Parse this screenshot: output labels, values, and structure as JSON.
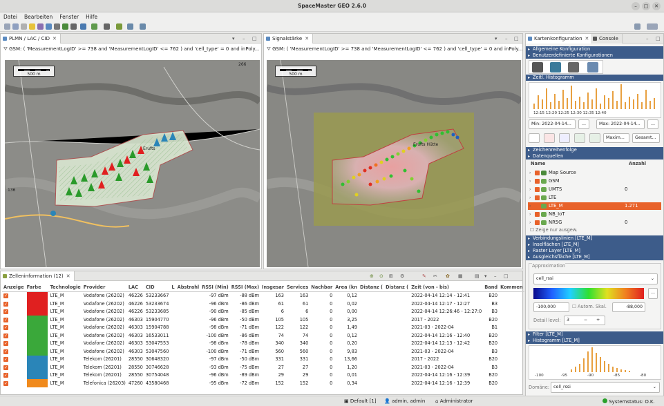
{
  "app": {
    "title": "SpaceMaster GEO 2.6.0"
  },
  "menu": [
    "Datei",
    "Bearbeiten",
    "Fenster",
    "Hilfe"
  ],
  "left_map": {
    "tab_label": "PLMN / LAC / CID",
    "filter_text": "GSM: ( 'MeasurementLogID' >= 738 and 'MeasurementLogID' <= 762 ) and 'cell_type' = 0 and inPoly...",
    "scale_label": "500 m",
    "place_label": "Erufts",
    "road_label": "136",
    "road_label2": "266"
  },
  "right_map": {
    "tab_label": "Signalstärke",
    "filter_text": "GSM: ( 'MeasurementLogID' >= 738 and 'MeasurementLogID' <= 762 ) and 'cell_type' = 0 and inPoly...",
    "scale_label": "500 m",
    "place_label": "Erufts Hütte"
  },
  "cells": {
    "tab_label": "Zelleninformation (12)",
    "columns": [
      "Anzeige",
      "Farbe",
      "Technologie",
      "Provider",
      "LAC",
      "CID",
      "L",
      "Abstrahl",
      "RSSI (Min)",
      "RSSI (Max)",
      "Insgesar",
      "Services",
      "Nachbar",
      "Area (kn",
      "Distanz (",
      "Distanz (",
      "Zeit (von - bis)",
      "Band",
      "Kommen"
    ],
    "rows": [
      {
        "color": "#e02020",
        "tech": "LTE_M",
        "provider": "Vodafone (26202)",
        "lac": "46226",
        "cid": "53233667",
        "rmin": "-97 dBm",
        "rmax": "-88 dBm",
        "ins": "163",
        "srv": "163",
        "nb": "0",
        "area": "0,12",
        "time": "2022-04-14 12:14 - 12:41",
        "band": "B20"
      },
      {
        "color": "#e02020",
        "tech": "LTE_M",
        "provider": "Vodafone (26202)",
        "lac": "46226",
        "cid": "53233674",
        "rmin": "-96 dBm",
        "rmax": "-86 dBm",
        "ins": "61",
        "srv": "61",
        "nb": "0",
        "area": "0,02",
        "time": "2022-04-14 12:17 - 12:27",
        "band": "B3"
      },
      {
        "color": "#e02020",
        "tech": "LTE_M",
        "provider": "Vodafone (26202)",
        "lac": "46226",
        "cid": "53233685",
        "rmin": "-90 dBm",
        "rmax": "-85 dBm",
        "ins": "6",
        "srv": "6",
        "nb": "0",
        "area": "0,00",
        "time": "2022-04-14 12:26:46 - 12:27:0",
        "band": "B3"
      },
      {
        "color": "#3aa83a",
        "tech": "LTE_M",
        "provider": "Vodafone (26202)",
        "lac": "46303",
        "cid": "15904770",
        "rmin": "-96 dBm",
        "rmax": "-50 dBm",
        "ins": "105",
        "srv": "105",
        "nb": "0",
        "area": "3,25",
        "time": "2017 - 2022",
        "band": "B20"
      },
      {
        "color": "#3aa83a",
        "tech": "LTE_M",
        "provider": "Vodafone (26202)",
        "lac": "46303",
        "cid": "15904788",
        "rmin": "-98 dBm",
        "rmax": "-71 dBm",
        "ins": "122",
        "srv": "122",
        "nb": "0",
        "area": "1,49",
        "time": "2021-03 - 2022-04",
        "band": "B1"
      },
      {
        "color": "#3aa83a",
        "tech": "LTE_M",
        "provider": "Vodafone (26202)",
        "lac": "46303",
        "cid": "16533011",
        "rmin": "-100 dBm",
        "rmax": "-86 dBm",
        "ins": "74",
        "srv": "74",
        "nb": "0",
        "area": "0,12",
        "time": "2022-04-14 12:16 - 12:40",
        "band": "B20"
      },
      {
        "color": "#3aa83a",
        "tech": "LTE_M",
        "provider": "Vodafone (26202)",
        "lac": "46303",
        "cid": "53047553",
        "rmin": "-98 dBm",
        "rmax": "-78 dBm",
        "ins": "340",
        "srv": "340",
        "nb": "0",
        "area": "0,20",
        "time": "2022-04-14 12:13 - 12:42",
        "band": "B20"
      },
      {
        "color": "#3aa83a",
        "tech": "LTE_M",
        "provider": "Vodafone (26202)",
        "lac": "46303",
        "cid": "53047560",
        "rmin": "-100 dBm",
        "rmax": "-71 dBm",
        "ins": "560",
        "srv": "560",
        "nb": "0",
        "area": "9,83",
        "time": "2021-03 - 2022-04",
        "band": "B3"
      },
      {
        "color": "#2a85b8",
        "tech": "LTE_M",
        "provider": "Telekom (26201)",
        "lac": "28550",
        "cid": "30648320",
        "rmin": "-97 dBm",
        "rmax": "-50 dBm",
        "ins": "331",
        "srv": "331",
        "nb": "0",
        "area": "13,66",
        "time": "2017 - 2022",
        "band": "B20"
      },
      {
        "color": "#2a85b8",
        "tech": "LTE_M",
        "provider": "Telekom (26201)",
        "lac": "28550",
        "cid": "30746628",
        "rmin": "-93 dBm",
        "rmax": "-75 dBm",
        "ins": "27",
        "srv": "27",
        "nb": "0",
        "area": "1,20",
        "time": "2021-03 - 2022-04",
        "band": "B3"
      },
      {
        "color": "#2a85b8",
        "tech": "LTE_M",
        "provider": "Telekom (26201)",
        "lac": "28550",
        "cid": "30754048",
        "rmin": "-96 dBm",
        "rmax": "-89 dBm",
        "ins": "29",
        "srv": "29",
        "nb": "0",
        "area": "0,01",
        "time": "2022-04-14 12:16 - 12:39",
        "band": "B20"
      },
      {
        "color": "#f08a1c",
        "tech": "LTE_M",
        "provider": "Telefonica (26203)",
        "lac": "47260",
        "cid": "43580468",
        "rmin": "-95 dBm",
        "rmax": "-72 dBm",
        "ins": "152",
        "srv": "152",
        "nb": "0",
        "area": "0,34",
        "time": "2022-04-14 12:16 - 12:39",
        "band": "B20"
      }
    ]
  },
  "right_panel": {
    "tab_kart": "Kartenkonfiguration",
    "tab_console": "Console",
    "sec_allg": "Allgemeine Konfiguration",
    "sec_benutzer": "Benutzerdefinierte Konfigurationen",
    "sec_zeit": "Zeitl. Histogramm",
    "zeit_ticks": "12:15 12:20 12:25 12:30 12:35 12:40",
    "min_label": "Min: 2022-04-14...",
    "max_label": "Max: 2022-04-14...",
    "more": "...",
    "maxim": "Maxim...",
    "gesamt": "Gesamt...",
    "sec_zeichen": "Zeichenreihenfolge",
    "sec_daten": "Datenquellen",
    "col_name": "Name",
    "col_anzahl": "Anzahl",
    "sources": [
      {
        "name": "Map Source",
        "count": "",
        "color": "#4a8a3a"
      },
      {
        "name": "GSM",
        "count": "",
        "color": "#6aa84f"
      },
      {
        "name": "UMTS",
        "count": "0",
        "color": "#6aa84f"
      },
      {
        "name": "LTE",
        "count": "",
        "color": "#6aa84f"
      },
      {
        "name": "LTE_M",
        "count": "1.271",
        "color": "#6aa84f"
      },
      {
        "name": "NB_IoT",
        "count": "",
        "color": "#6aa84f"
      },
      {
        "name": "NR5G",
        "count": "0",
        "color": "#6aa84f"
      }
    ],
    "zeige_label": "Zeige nur ausgew.",
    "sec_verb": "Verbindungslinien [LTE_M]",
    "sec_insel": "Inselflächen [LTE_M]",
    "sec_raster": "Raster Layer [LTE_M]",
    "sec_ausgl": "Ausgleichsfläche [LTE_M]",
    "approx_label": "Approximation",
    "approx_value": "cell_rssi",
    "grad_min": "-100,000",
    "grad_max": "-88,000",
    "autom_label": "Autom. Skal.",
    "detail_label": "Detail level:",
    "detail_value": "3",
    "sec_filter": "Filter [LTE_M]",
    "sec_hist": "Histogramm [LTE_M]",
    "hist_ticks": [
      "-100",
      "-95",
      "-90",
      "-85",
      "-80"
    ],
    "domain_label": "Domäne:",
    "domain_value": "cell_rssi"
  },
  "status": {
    "default": "Default [1]",
    "user": "admin, admin",
    "role": "Administrator",
    "system": "Systemstatus: O.K."
  }
}
